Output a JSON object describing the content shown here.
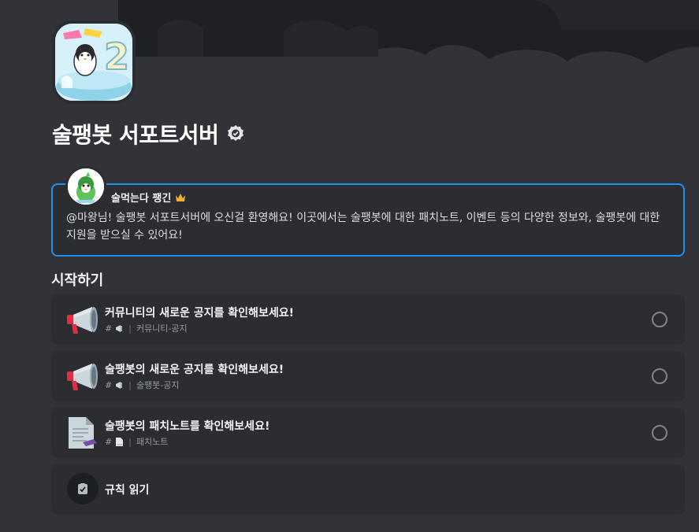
{
  "server": {
    "name": "술팽봇 서포트서버",
    "icon_name": "server-icon-penguin",
    "icon_text": "2"
  },
  "welcome": {
    "author": "술먹는다 팽긴",
    "author_badge": "crown-icon",
    "message": "@마왕님! 술팽봇 서포트서버에 오신걸 환영해요! 이곳에서는 술팽봇에 대한 패치노트, 이벤트 등의 다양한 정보와, 술팽봇에 대한 지원을 받으실 수 있어요!"
  },
  "onboarding": {
    "section_title": "시작하기",
    "tasks": [
      {
        "title": "커뮤니티의 새로운 공지를 확인해보세요!",
        "hash": "#",
        "channel": "커뮤니티-공지",
        "icon": "megaphone-icon"
      },
      {
        "title": "술팽봇의 새로운 공지를 확인해보세요!",
        "hash": "#",
        "channel": "술팽봇-공지",
        "icon": "megaphone-icon"
      },
      {
        "title": "술팽봇의 패치노트를 확인해보세요!",
        "hash": "#",
        "channel": "패치노트",
        "icon": "document-icon"
      }
    ],
    "rules_label": "규칙 읽기"
  },
  "colors": {
    "background": "#313338",
    "card": "#2b2d31",
    "accent_border": "#1f8ff0",
    "megaphone_red": "#dd2e44"
  }
}
